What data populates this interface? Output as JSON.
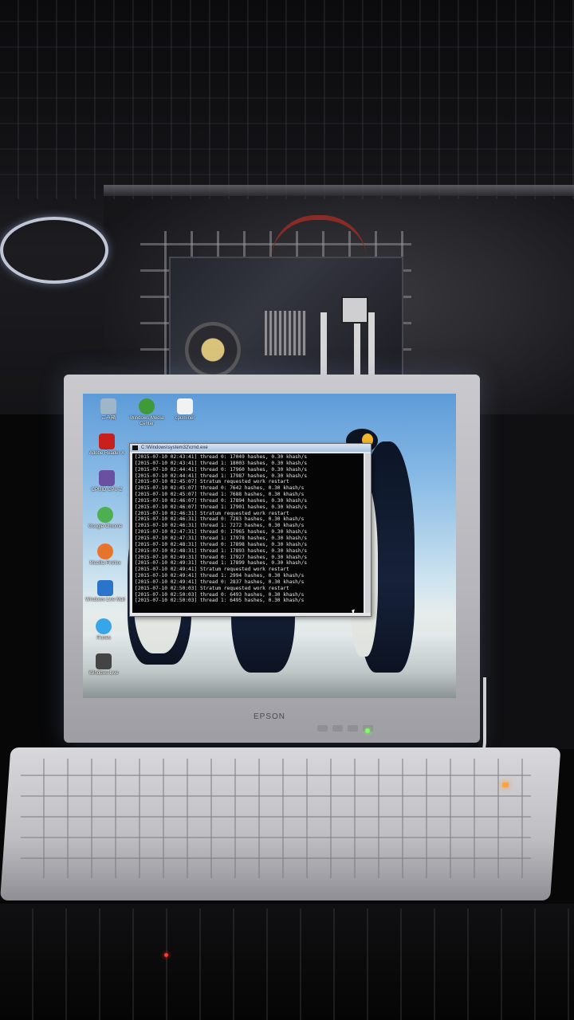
{
  "monitor": {
    "brand": "EPSON"
  },
  "desktop": {
    "icons": [
      {
        "label": "ごみ箱",
        "icon": "recycle-bin-icon",
        "color": "#9fb6c8"
      },
      {
        "label": "Windows Media Center",
        "icon": "media-center-icon",
        "color": "#3f9b3a"
      },
      {
        "label": "cpuminer",
        "icon": "folder-icon",
        "color": "#f2f2f2"
      },
      {
        "label": "Adobe Reader X",
        "icon": "adobe-reader-icon",
        "color": "#c8201c"
      },
      {
        "label": "CPUID CPU-Z",
        "icon": "cpu-z-icon",
        "color": "#6b4fa0"
      },
      {
        "label": "Google Chrome",
        "icon": "chrome-icon",
        "color": "#4caf50"
      },
      {
        "label": "Mozilla Firefox",
        "icon": "firefox-icon",
        "color": "#e8742b"
      },
      {
        "label": "Windows Live Mail",
        "icon": "mail-icon",
        "color": "#2a74c9"
      },
      {
        "label": "iTunes",
        "icon": "itunes-icon",
        "color": "#38a6e6"
      },
      {
        "label": "Windows Live",
        "icon": "windows-live-icon",
        "color": "#444"
      }
    ]
  },
  "console": {
    "title": "C:\\Windows\\system32\\cmd.exe",
    "lines": [
      "[2015-07-10 02:43:41] thread 0: 17049 hashes, 0.30 khash/s",
      "[2015-07-10 02:43:41] thread 1: 18003 hashes, 0.30 khash/s",
      "[2015-07-10 02:44:41] thread 0: 17960 hashes, 0.30 khash/s",
      "[2015-07-10 02:44:41] thread 1: 17987 hashes, 0.30 khash/s",
      "[2015-07-10 02:45:07] Stratum requested work restart",
      "[2015-07-10 02:45:07] thread 0: 7642 hashes, 0.30 khash/s",
      "[2015-07-10 02:45:07] thread 1: 7688 hashes, 0.30 khash/s",
      "[2015-07-10 02:46:07] thread 0: 17894 hashes, 0.30 khash/s",
      "[2015-07-10 02:46:07] thread 1: 17901 hashes, 0.30 khash/s",
      "[2015-07-10 02:46:31] Stratum requested work restart",
      "[2015-07-10 02:46:31] thread 0: 7283 hashes, 0.30 khash/s",
      "[2015-07-10 02:46:31] thread 1: 7272 hashes, 0.30 khash/s",
      "[2015-07-10 02:47:31] thread 0: 17965 hashes, 0.30 khash/s",
      "[2015-07-10 02:47:31] thread 1: 17978 hashes, 0.30 khash/s",
      "[2015-07-10 02:48:31] thread 0: 17898 hashes, 0.30 khash/s",
      "[2015-07-10 02:48:31] thread 1: 17893 hashes, 0.30 khash/s",
      "[2015-07-10 02:49:31] thread 0: 17927 hashes, 0.30 khash/s",
      "[2015-07-10 02:49:31] thread 1: 17899 hashes, 0.30 khash/s",
      "[2015-07-10 02:49:41] Stratum requested work restart",
      "[2015-07-10 02:49:41] thread 1: 2994 hashes, 0.30 khash/s",
      "[2015-07-10 02:49:41] thread 0: 2837 hashes, 0.30 khash/s",
      "[2015-07-10 02:50:03] Stratum requested work restart",
      "[2015-07-10 02:50:03] thread 0: 6493 hashes, 0.30 khash/s",
      "[2015-07-10 02:50:03] thread 1: 6495 hashes, 0.30 khash/s"
    ]
  }
}
